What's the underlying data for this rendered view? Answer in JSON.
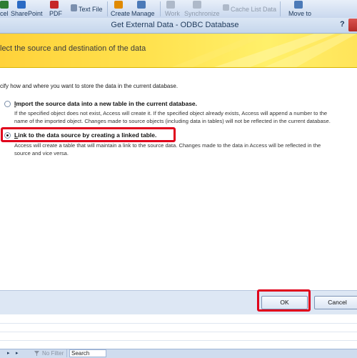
{
  "ribbon": {
    "items": [
      {
        "label": "cel"
      },
      {
        "label": "SharePoint"
      },
      {
        "label": "PDF"
      },
      {
        "label": "Text File"
      },
      {
        "label": "Create"
      },
      {
        "label": "Manage"
      },
      {
        "label": "Work"
      },
      {
        "label": "Synchronize"
      },
      {
        "label": "Cache List Data"
      },
      {
        "label": "Move to"
      }
    ]
  },
  "dialog": {
    "title": "Get External Data - ODBC Database",
    "help": "?",
    "header": "lect the source and destination of the data",
    "intro": "cify how and where you want to store the data in the current database.",
    "options": [
      {
        "label_accel": "I",
        "label_rest": "mport the source data into a new table in the current database.",
        "desc_line1": "If the specified object does not exist, Access will create it. If the specified object already exists, Access will append a number to the",
        "desc_line2": "name of the imported object. Changes made to source objects (including data in tables) will not be reflected in the current database.",
        "selected": false
      },
      {
        "label_accel": "L",
        "label_rest": "ink to the data source by creating a linked table.",
        "desc_line1": "Access will create a table that will maintain a link to the source data. Changes made to the data in Access will be reflected in the",
        "desc_line2": "source and vice versa.",
        "selected": true
      }
    ],
    "ok_label": "OK",
    "cancel_label": "Cancel"
  },
  "statusbar": {
    "nav_first": "◂",
    "nav_last": "▸",
    "no_filter": "No Filter",
    "search_placeholder": "Search"
  },
  "colors": {
    "highlight": "#e0001b",
    "header_yellow": "#ffe14d",
    "ribbon_text": "#1e395b"
  }
}
